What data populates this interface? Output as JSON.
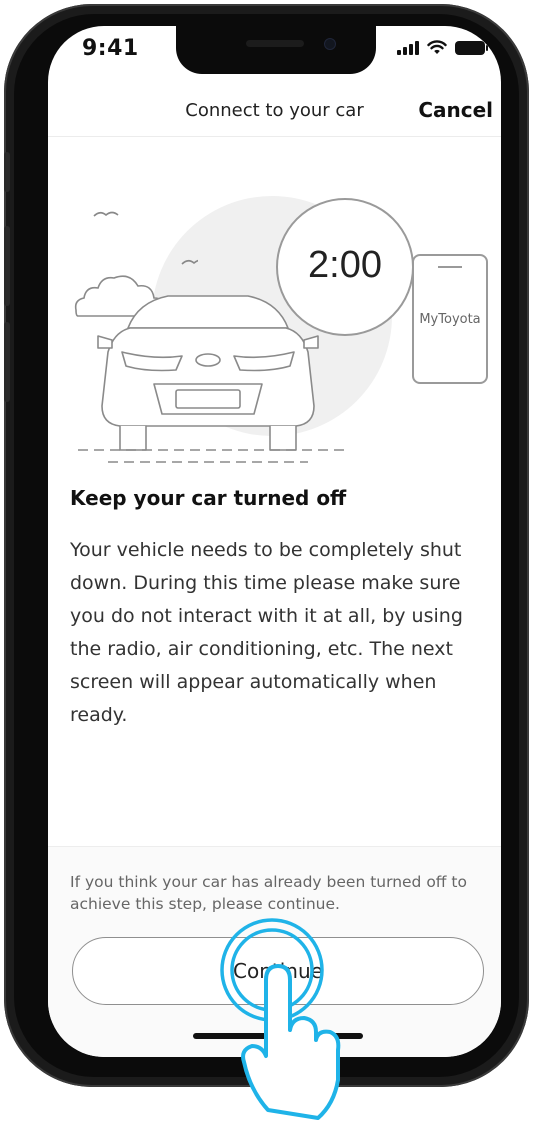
{
  "status_bar": {
    "time": "9:41"
  },
  "nav": {
    "title": "Connect to your car",
    "cancel_label": "Cancel"
  },
  "hero": {
    "timer": "2:00",
    "phone_label": "MyToyota"
  },
  "content": {
    "title": "Keep your car turned off",
    "body": "Your vehicle needs to be completely shut down. During this time please make sure you do not interact with it at all, by using the radio, air conditioning, etc. The next screen will appear automatically when ready."
  },
  "footer": {
    "note": "If you think your car has already been turned off to achieve this step, please continue.",
    "continue_label": "Continue"
  },
  "colors": {
    "tap_accent": "#1fb3e8",
    "text_primary": "#111111",
    "border": "#8f8f8f"
  },
  "icons": [
    "cellular-signal-icon",
    "wifi-icon",
    "battery-icon",
    "car-illustration",
    "cloud-icon",
    "bird-icon",
    "tap-hand-icon"
  ]
}
